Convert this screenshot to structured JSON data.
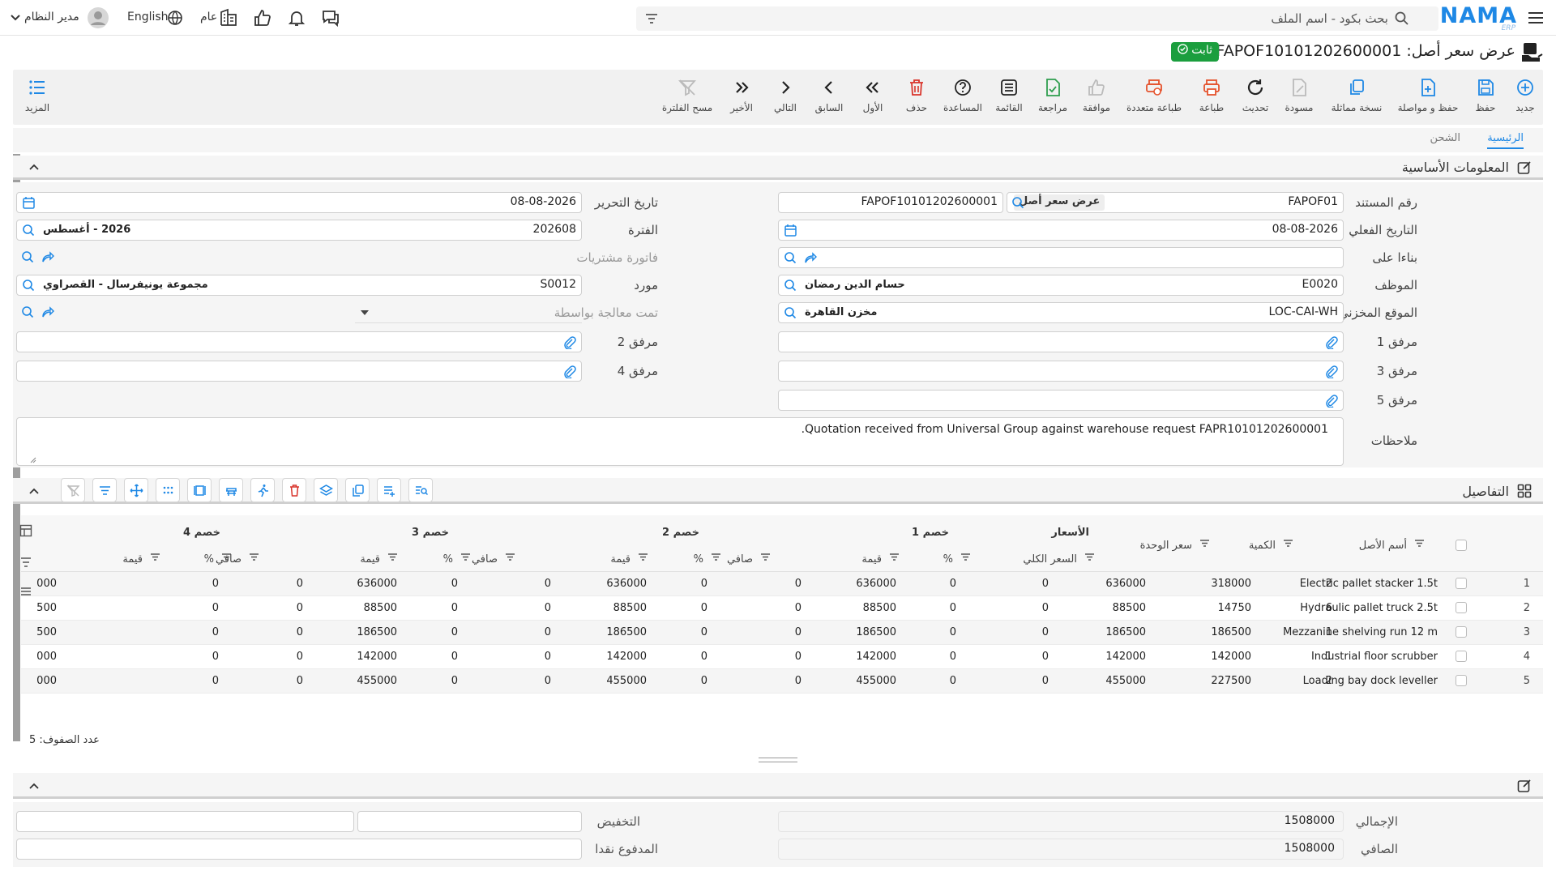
{
  "topbar": {
    "logo_text": "NAMA",
    "logo_sub": "ERP",
    "search_placeholder": "بحث بكود - اسم الملف",
    "user_name": "مدير النظام",
    "language": "English",
    "scope": "عام"
  },
  "page": {
    "title": "عرض سعر أصل: FAPOF10101202600001",
    "status": "ثابت"
  },
  "toolbar": [
    {
      "label": "جديد",
      "icon": "plus-circle-icon",
      "color": "#1e88e5"
    },
    {
      "label": "حفظ",
      "icon": "save-icon",
      "color": "#1e88e5"
    },
    {
      "label": "حفظ و مواصلة",
      "icon": "save-continue-icon",
      "color": "#1e88e5"
    },
    {
      "label": "نسخة مماثلة",
      "icon": "copy-icon",
      "color": "#1e88e5"
    },
    {
      "label": "مسودة",
      "icon": "draft-icon",
      "color": "#bbbbbb"
    },
    {
      "label": "تحديث",
      "icon": "refresh-icon",
      "color": "#222222"
    },
    {
      "label": "طباعة",
      "icon": "print-icon",
      "color": "#e5532d"
    },
    {
      "label": "طباعة متعددة",
      "icon": "multi-print-icon",
      "color": "#e5532d"
    },
    {
      "label": "موافقة",
      "icon": "thumbs-up-icon",
      "color": "#bbbbbb"
    },
    {
      "label": "مراجعة",
      "icon": "review-icon",
      "color": "#2e9e4e"
    },
    {
      "label": "القائمة",
      "icon": "list-icon",
      "color": "#222222"
    },
    {
      "label": "المساعدة",
      "icon": "help-icon",
      "color": "#222222"
    },
    {
      "label": "حذف",
      "icon": "delete-icon",
      "color": "#d9342b"
    },
    {
      "label": "الأول",
      "icon": "first-icon",
      "color": "#222222"
    },
    {
      "label": "السابق",
      "icon": "previous-icon",
      "color": "#222222"
    },
    {
      "label": "التالي",
      "icon": "next-icon",
      "color": "#222222"
    },
    {
      "label": "الأخير",
      "icon": "last-icon",
      "color": "#222222"
    },
    {
      "label": "مسح الفلترة",
      "icon": "clear-filter-icon",
      "color": "#bbbbbb"
    }
  ],
  "toolbar_more": "المزيد",
  "tabs": [
    "الرئيسية",
    "الشحن"
  ],
  "basic_section": {
    "title": "المعلومات الأساسية",
    "fields": {
      "doc_no_label": "رقم المستند",
      "doc_no_value": "FAPOF01",
      "doc_type": "عرض سعر أصل",
      "doc_full_no": "FAPOF10101202600001",
      "edit_date_label": "تاريخ التحرير",
      "edit_date_value": "08-08-2026",
      "actual_date_label": "التاريخ الفعلي",
      "actual_date_value": "08-08-2026",
      "period_label": "الفترة",
      "period_value": "202608",
      "period_name": "2026 - أغسطس",
      "based_on_label": "بناءا على",
      "purchase_invoice_label": "فاتورة مشتريات",
      "employee_label": "الموظف",
      "employee_code": "E0020",
      "employee_name": "حسام الدين رمضان",
      "supplier_label": "مورد",
      "supplier_code": "S0012",
      "supplier_name": "مجموعة يونيفرسال - القصراوي",
      "location_label": "الموقع المخزني",
      "location_code": "LOC-CAI-WH",
      "location_name": "مخزن القاهرة",
      "processed_by_label": "تمت معالجة بواسطة",
      "att1": "مرفق 1",
      "att2": "مرفق 2",
      "att3": "مرفق 3",
      "att4": "مرفق 4",
      "att5": "مرفق 5",
      "notes_label": "ملاحظات",
      "notes_value": "Quotation received from Universal Group against warehouse request FAPR10101202600001."
    }
  },
  "details_section": {
    "title": "التفاصيل",
    "headers": {
      "asset_name": "أسم الأصل",
      "qty": "الكمية",
      "unit_price": "سعر الوحدة",
      "prices_group": "الأسعار",
      "total_price": "السعر الكلي",
      "disc1": "خصم 1",
      "disc2": "خصم 2",
      "disc3": "خصم 3",
      "disc4": "خصم 4",
      "pct": "%",
      "value": "قيمة",
      "net": "صافي"
    },
    "rows": [
      {
        "n": "1",
        "name": "Electric pallet stacker 1.5t",
        "qty": "2",
        "unit": "318000",
        "total": "636000",
        "d1p": "0",
        "d1v": "0",
        "n1": "636000",
        "d2p": "0",
        "d2v": "0",
        "n2": "636000",
        "d3p": "0",
        "d3v": "0",
        "n3": "636000",
        "d4p": "0",
        "d4v": "0",
        "n4": "000"
      },
      {
        "n": "2",
        "name": "Hydraulic pallet truck 2.5t",
        "qty": "6",
        "unit": "14750",
        "total": "88500",
        "d1p": "0",
        "d1v": "0",
        "n1": "88500",
        "d2p": "0",
        "d2v": "0",
        "n2": "88500",
        "d3p": "0",
        "d3v": "0",
        "n3": "88500",
        "d4p": "0",
        "d4v": "0",
        "n4": "500"
      },
      {
        "n": "3",
        "name": "Mezzanine shelving run 12 m",
        "qty": "1",
        "unit": "186500",
        "total": "186500",
        "d1p": "0",
        "d1v": "0",
        "n1": "186500",
        "d2p": "0",
        "d2v": "0",
        "n2": "186500",
        "d3p": "0",
        "d3v": "0",
        "n3": "186500",
        "d4p": "0",
        "d4v": "0",
        "n4": "500"
      },
      {
        "n": "4",
        "name": "Industrial floor scrubber",
        "qty": "1",
        "unit": "142000",
        "total": "142000",
        "d1p": "0",
        "d1v": "0",
        "n1": "142000",
        "d2p": "0",
        "d2v": "0",
        "n2": "142000",
        "d3p": "0",
        "d3v": "0",
        "n3": "142000",
        "d4p": "0",
        "d4v": "0",
        "n4": "000"
      },
      {
        "n": "5",
        "name": "Loading bay dock leveller",
        "qty": "2",
        "unit": "227500",
        "total": "455000",
        "d1p": "0",
        "d1v": "0",
        "n1": "455000",
        "d2p": "0",
        "d2v": "0",
        "n2": "455000",
        "d3p": "0",
        "d3v": "0",
        "n3": "455000",
        "d4p": "0",
        "d4v": "0",
        "n4": "000"
      }
    ],
    "row_count": "عدد الصفوف: 5"
  },
  "totals": {
    "total_label": "الإجمالي",
    "total_value": "1508000",
    "net_label": "الصافي",
    "net_value": "1508000",
    "discount_label": "التخفيض",
    "cash_paid_label": "المدفوع نقدا"
  }
}
